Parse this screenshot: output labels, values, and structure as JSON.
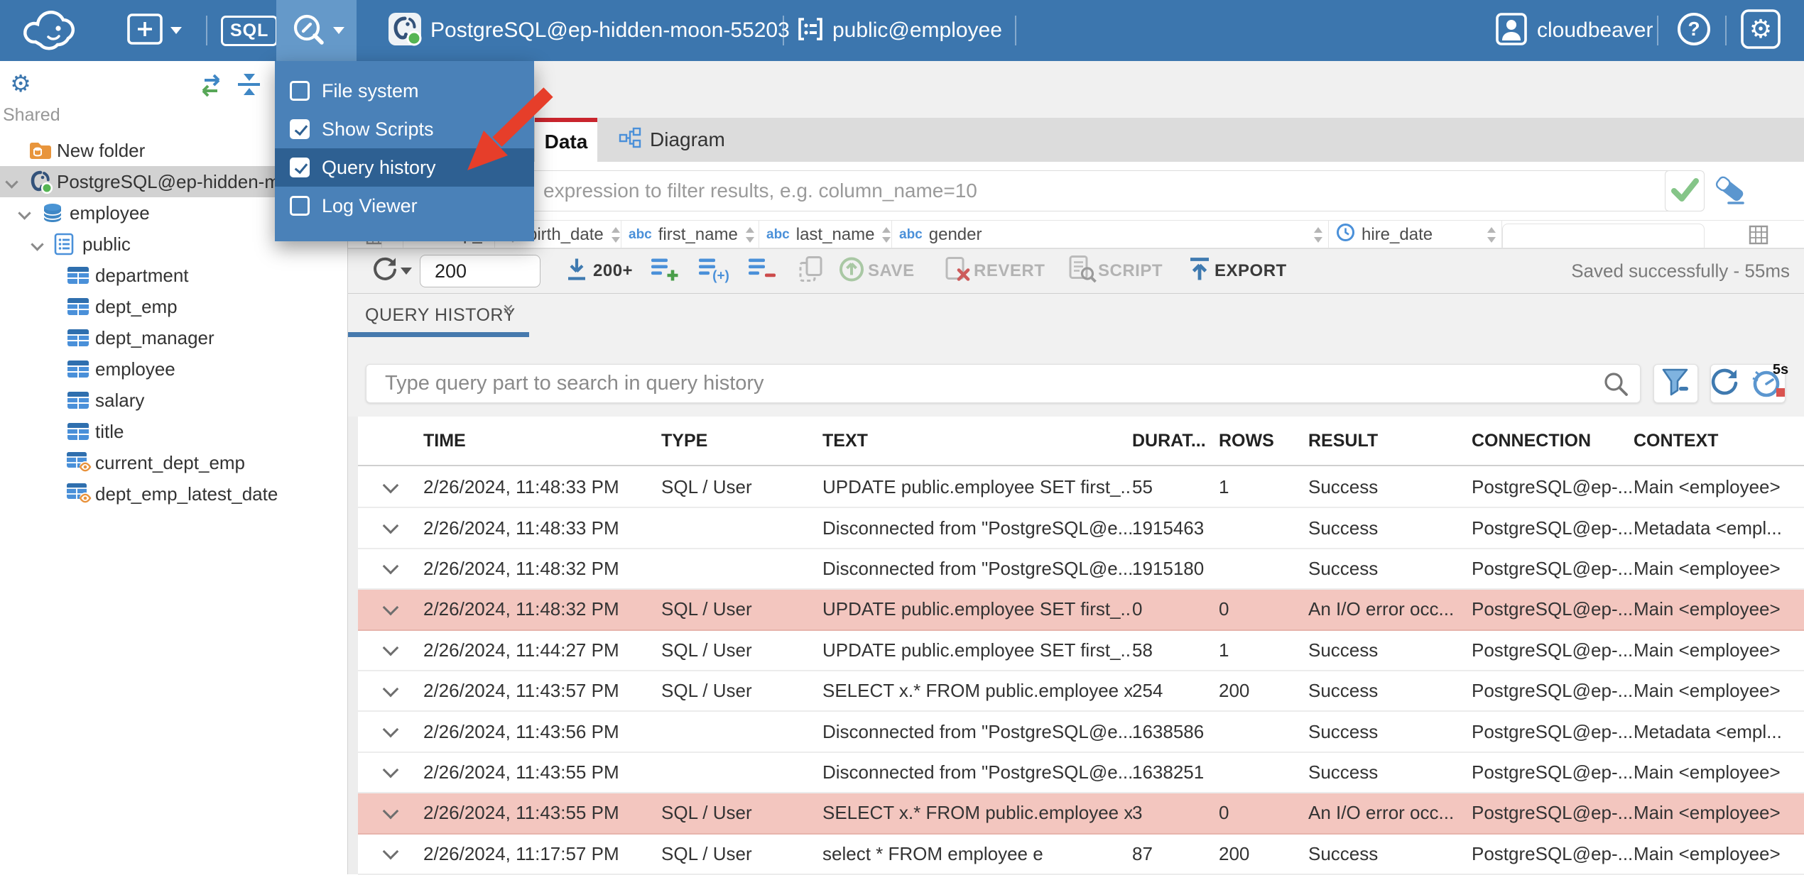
{
  "topbar": {
    "sql_button": "SQL",
    "connection_name": "PostgreSQL@ep-hidden-moon-55203",
    "schema_path": "public@employee",
    "username": "cloudbeaver"
  },
  "tools_menu": {
    "items": [
      {
        "label": "File system",
        "checked": false,
        "highlighted": false
      },
      {
        "label": "Show Scripts",
        "checked": true,
        "highlighted": false
      },
      {
        "label": "Query history",
        "checked": true,
        "highlighted": true
      },
      {
        "label": "Log Viewer",
        "checked": false,
        "highlighted": false
      }
    ]
  },
  "sidebar": {
    "section_label": "Shared",
    "tree": [
      {
        "label": "New folder",
        "icon": "folder",
        "level": 0,
        "expandable": false,
        "selected": false
      },
      {
        "label": "PostgreSQL@ep-hidden-moon-55203",
        "icon": "postgresql",
        "level": 0,
        "expandable": true,
        "selected": true
      },
      {
        "label": "employee",
        "icon": "database",
        "level": 1,
        "expandable": true,
        "selected": false
      },
      {
        "label": "public",
        "icon": "schema",
        "level": 2,
        "expandable": true,
        "selected": false
      },
      {
        "label": "department",
        "icon": "table",
        "level": 3,
        "expandable": false,
        "selected": false
      },
      {
        "label": "dept_emp",
        "icon": "table",
        "level": 3,
        "expandable": false,
        "selected": false
      },
      {
        "label": "dept_manager",
        "icon": "table",
        "level": 3,
        "expandable": false,
        "selected": false
      },
      {
        "label": "employee",
        "icon": "table",
        "level": 3,
        "expandable": false,
        "selected": false
      },
      {
        "label": "salary",
        "icon": "table",
        "level": 3,
        "expandable": false,
        "selected": false
      },
      {
        "label": "title",
        "icon": "table",
        "level": 3,
        "expandable": false,
        "selected": false
      },
      {
        "label": "current_dept_emp",
        "icon": "view",
        "level": 3,
        "expandable": false,
        "selected": false
      },
      {
        "label": "dept_emp_latest_date",
        "icon": "view",
        "level": 3,
        "expandable": false,
        "selected": false
      }
    ]
  },
  "main": {
    "tabs": [
      {
        "label": "Data",
        "active": true
      },
      {
        "label": "Diagram",
        "active": false
      }
    ],
    "filter_placeholder": "expression to filter results, e.g. column_name=10",
    "row_index_header": "#",
    "grid_columns": [
      {
        "type": "number",
        "label": "emp_no"
      },
      {
        "type": "date",
        "label": "birth_date"
      },
      {
        "type": "text",
        "label": "first_name"
      },
      {
        "type": "text",
        "label": "last_name"
      },
      {
        "type": "text",
        "label": "gender"
      },
      {
        "type": "date",
        "label": "hire_date"
      }
    ],
    "toolbar": {
      "row_limit": "200",
      "fetch_label": "200+",
      "save_label": "SAVE",
      "revert_label": "REVERT",
      "script_label": "SCRIPT",
      "export_label": "EXPORT",
      "status": "Saved successfully - 55ms"
    }
  },
  "query_history": {
    "tab_label": "QUERY HISTORY",
    "close_label": "×",
    "search_placeholder": "Type query part to search in query history",
    "timer_badge": "5s",
    "columns": [
      "TIME",
      "TYPE",
      "TEXT",
      "DURAT...",
      "ROWS",
      "RESULT",
      "CONNECTION",
      "CONTEXT"
    ],
    "rows": [
      {
        "time": "2/26/2024, 11:48:33 PM",
        "type": "SQL / User",
        "text": "UPDATE public.employee SET first_...",
        "duration": "55",
        "rows": "1",
        "result": "Success",
        "connection": "PostgreSQL@ep-...",
        "context": "Main <employee>",
        "error": false
      },
      {
        "time": "2/26/2024, 11:48:33 PM",
        "type": "",
        "text": "Disconnected from \"PostgreSQL@e...",
        "duration": "1915463",
        "rows": "",
        "result": "Success",
        "connection": "PostgreSQL@ep-...",
        "context": "Metadata <empl...",
        "error": false
      },
      {
        "time": "2/26/2024, 11:48:32 PM",
        "type": "",
        "text": "Disconnected from \"PostgreSQL@e...",
        "duration": "1915180",
        "rows": "",
        "result": "Success",
        "connection": "PostgreSQL@ep-...",
        "context": "Main <employee>",
        "error": false
      },
      {
        "time": "2/26/2024, 11:48:32 PM",
        "type": "SQL / User",
        "text": "UPDATE public.employee SET first_...",
        "duration": "0",
        "rows": "0",
        "result": "An I/O error occ...",
        "connection": "PostgreSQL@ep-...",
        "context": "Main <employee>",
        "error": true
      },
      {
        "time": "2/26/2024, 11:44:27 PM",
        "type": "SQL / User",
        "text": "UPDATE public.employee SET first_...",
        "duration": "58",
        "rows": "1",
        "result": "Success",
        "connection": "PostgreSQL@ep-...",
        "context": "Main <employee>",
        "error": false
      },
      {
        "time": "2/26/2024, 11:43:57 PM",
        "type": "SQL / User",
        "text": "SELECT x.* FROM public.employee x",
        "duration": "254",
        "rows": "200",
        "result": "Success",
        "connection": "PostgreSQL@ep-...",
        "context": "Main <employee>",
        "error": false
      },
      {
        "time": "2/26/2024, 11:43:56 PM",
        "type": "",
        "text": "Disconnected from \"PostgreSQL@e...",
        "duration": "1638586",
        "rows": "",
        "result": "Success",
        "connection": "PostgreSQL@ep-...",
        "context": "Metadata <empl...",
        "error": false
      },
      {
        "time": "2/26/2024, 11:43:55 PM",
        "type": "",
        "text": "Disconnected from \"PostgreSQL@e...",
        "duration": "1638251",
        "rows": "",
        "result": "Success",
        "connection": "PostgreSQL@ep-...",
        "context": "Main <employee>",
        "error": false
      },
      {
        "time": "2/26/2024, 11:43:55 PM",
        "type": "SQL / User",
        "text": "SELECT x.* FROM public.employee x",
        "duration": "3",
        "rows": "0",
        "result": "An I/O error occ...",
        "connection": "PostgreSQL@ep-...",
        "context": "Main <employee>",
        "error": true
      },
      {
        "time": "2/26/2024, 11:17:57 PM",
        "type": "SQL / User",
        "text": "select * FROM employee e",
        "duration": "87",
        "rows": "200",
        "result": "Success",
        "connection": "PostgreSQL@ep-...",
        "context": "Main <employee>",
        "error": false
      }
    ]
  },
  "colors": {
    "topbar_blue": "#3c76ae",
    "menu_blue": "#4a81b8",
    "menu_highlight": "#2e6092",
    "active_tab_red": "#c9252d",
    "icon_blue": "#4a90d9",
    "error_row_pink": "#f3c6bf",
    "underline_blue": "#4679ad",
    "arrow_red": "#e63e2a"
  }
}
